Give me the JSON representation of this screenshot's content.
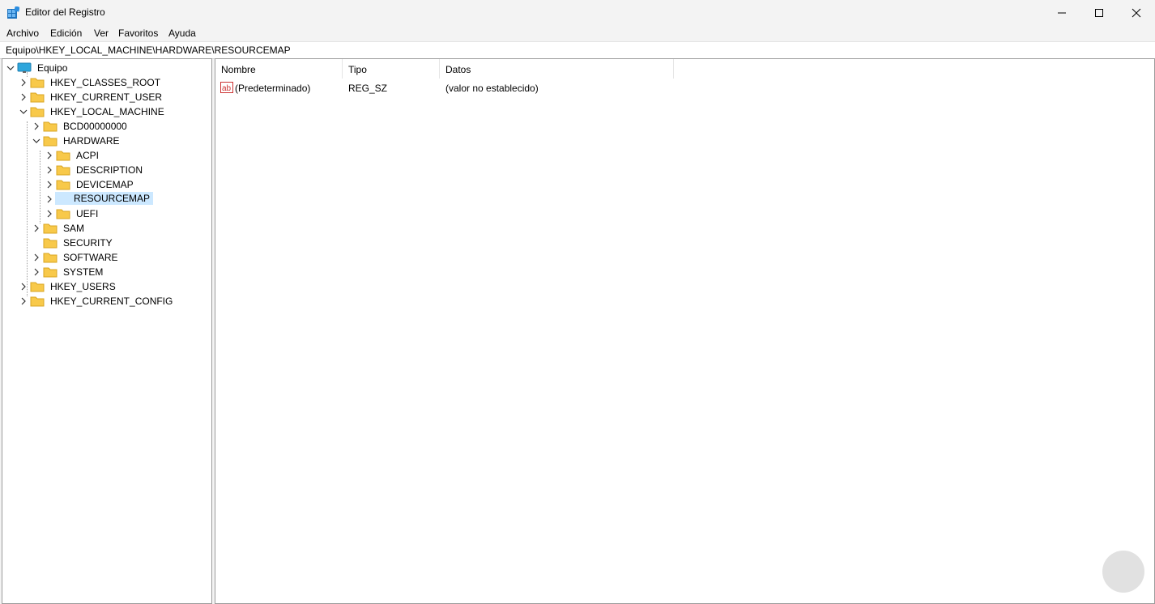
{
  "window": {
    "title": "Editor del Registro",
    "icon": "regedit-icon"
  },
  "menu": [
    "Archivo",
    "Edición",
    "Ver",
    "Favoritos",
    "Ayuda"
  ],
  "address": "Equipo\\HKEY_LOCAL_MACHINE\\HARDWARE\\RESOURCEMAP",
  "tree": {
    "root": "Equipo",
    "hives": [
      "HKEY_CLASSES_ROOT",
      "HKEY_CURRENT_USER",
      "HKEY_LOCAL_MACHINE",
      "HKEY_USERS",
      "HKEY_CURRENT_CONFIG"
    ],
    "hklm_children": [
      "BCD00000000",
      "HARDWARE",
      "SAM",
      "SECURITY",
      "SOFTWARE",
      "SYSTEM"
    ],
    "hardware_children": [
      "ACPI",
      "DESCRIPTION",
      "DEVICEMAP",
      "RESOURCEMAP",
      "UEFI"
    ],
    "selected": "RESOURCEMAP"
  },
  "list": {
    "columns": [
      "Nombre",
      "Tipo",
      "Datos"
    ],
    "rows": [
      {
        "name": "(Predeterminado)",
        "type": "REG_SZ",
        "data": "(valor no establecido)",
        "icon": "string-value-icon"
      }
    ]
  },
  "colors": {
    "selection": "#cce8ff",
    "folder": "#f8c94a",
    "accent": "#0078d4"
  }
}
